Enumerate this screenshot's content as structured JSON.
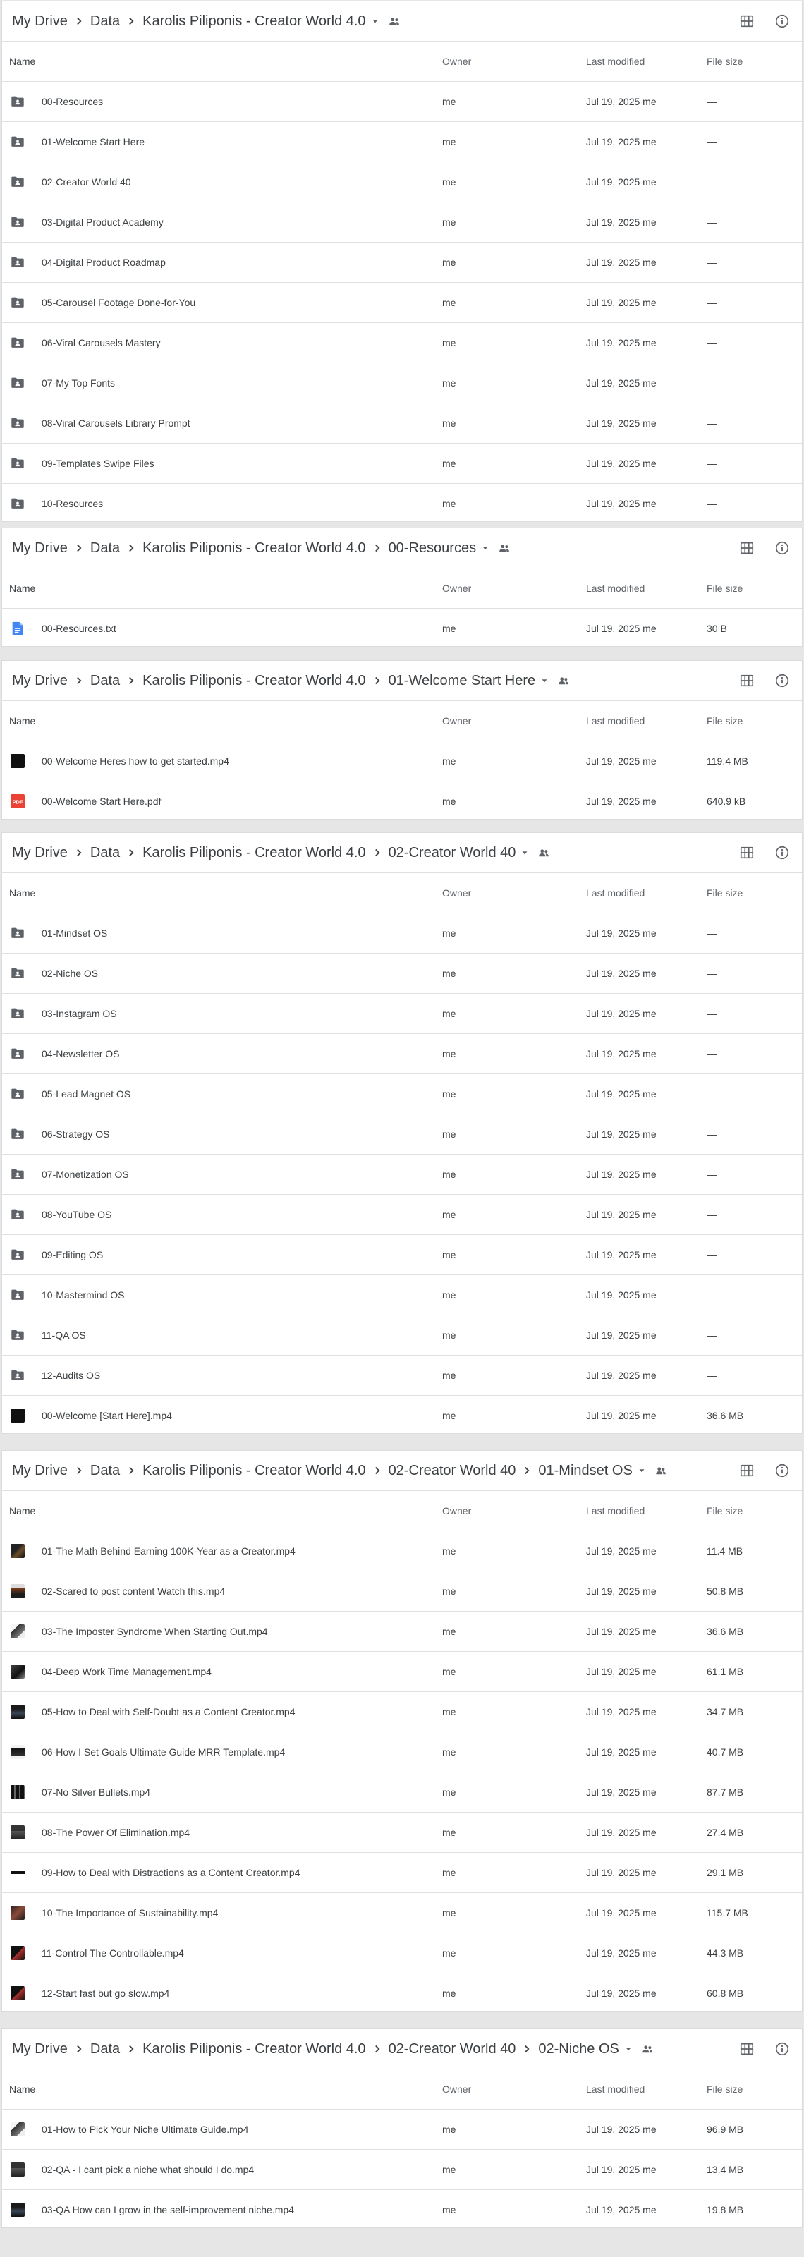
{
  "columns": {
    "name": "Name",
    "owner": "Owner",
    "modified": "Last modified",
    "size": "File size"
  },
  "sections": [
    {
      "path": [
        "My Drive",
        "Data",
        "Karolis Piliponis - Creator World 4.0"
      ],
      "rows": [
        {
          "icon": "folder-shared-icon",
          "name": "00-Resources",
          "owner": "me",
          "modified": "Jul 19, 2025 me",
          "size": "—"
        },
        {
          "icon": "folder-shared-icon",
          "name": "01-Welcome Start Here",
          "owner": "me",
          "modified": "Jul 19, 2025 me",
          "size": "—"
        },
        {
          "icon": "folder-shared-icon",
          "name": "02-Creator World 40",
          "owner": "me",
          "modified": "Jul 19, 2025 me",
          "size": "—"
        },
        {
          "icon": "folder-shared-icon",
          "name": "03-Digital Product Academy",
          "owner": "me",
          "modified": "Jul 19, 2025 me",
          "size": "—"
        },
        {
          "icon": "folder-shared-icon",
          "name": "04-Digital Product Roadmap",
          "owner": "me",
          "modified": "Jul 19, 2025 me",
          "size": "—"
        },
        {
          "icon": "folder-shared-icon",
          "name": "05-Carousel Footage Done-for-You",
          "owner": "me",
          "modified": "Jul 19, 2025 me",
          "size": "—"
        },
        {
          "icon": "folder-shared-icon",
          "name": "06-Viral Carousels Mastery",
          "owner": "me",
          "modified": "Jul 19, 2025 me",
          "size": "—"
        },
        {
          "icon": "folder-shared-icon",
          "name": "07-My Top Fonts",
          "owner": "me",
          "modified": "Jul 19, 2025 me",
          "size": "—"
        },
        {
          "icon": "folder-shared-icon",
          "name": "08-Viral Carousels Library Prompt",
          "owner": "me",
          "modified": "Jul 19, 2025 me",
          "size": "—"
        },
        {
          "icon": "folder-shared-icon",
          "name": "09-Templates Swipe Files",
          "owner": "me",
          "modified": "Jul 19, 2025 me",
          "size": "—"
        },
        {
          "icon": "folder-shared-icon",
          "name": "10-Resources",
          "owner": "me",
          "modified": "Jul 19, 2025 me",
          "size": "—"
        }
      ]
    },
    {
      "path": [
        "My Drive",
        "Data",
        "Karolis Piliponis - Creator World 4.0",
        "00-Resources"
      ],
      "rows": [
        {
          "icon": "doc-icon",
          "name": "00-Resources.txt",
          "owner": "me",
          "modified": "Jul 19, 2025 me",
          "size": "30 B"
        }
      ]
    },
    {
      "path": [
        "My Drive",
        "Data",
        "Karolis Piliponis - Creator World 4.0",
        "01-Welcome Start Here"
      ],
      "rows": [
        {
          "icon": "video-thumb-icon",
          "name": "00-Welcome Heres how to get started.mp4",
          "owner": "me",
          "modified": "Jul 19, 2025 me",
          "size": "119.4 MB"
        },
        {
          "icon": "pdf-icon",
          "name": "00-Welcome Start Here.pdf",
          "owner": "me",
          "modified": "Jul 19, 2025 me",
          "size": "640.9 kB"
        }
      ]
    },
    {
      "path": [
        "My Drive",
        "Data",
        "Karolis Piliponis - Creator World 4.0",
        "02-Creator World 40"
      ],
      "rows": [
        {
          "icon": "folder-shared-icon",
          "name": "01-Mindset OS",
          "owner": "me",
          "modified": "Jul 19, 2025 me",
          "size": "—"
        },
        {
          "icon": "folder-shared-icon",
          "name": "02-Niche OS",
          "owner": "me",
          "modified": "Jul 19, 2025 me",
          "size": "—"
        },
        {
          "icon": "folder-shared-icon",
          "name": "03-Instagram OS",
          "owner": "me",
          "modified": "Jul 19, 2025 me",
          "size": "—"
        },
        {
          "icon": "folder-shared-icon",
          "name": "04-Newsletter OS",
          "owner": "me",
          "modified": "Jul 19, 2025 me",
          "size": "—"
        },
        {
          "icon": "folder-shared-icon",
          "name": "05-Lead Magnet OS",
          "owner": "me",
          "modified": "Jul 19, 2025 me",
          "size": "—"
        },
        {
          "icon": "folder-shared-icon",
          "name": "06-Strategy OS",
          "owner": "me",
          "modified": "Jul 19, 2025 me",
          "size": "—"
        },
        {
          "icon": "folder-shared-icon",
          "name": "07-Monetization OS",
          "owner": "me",
          "modified": "Jul 19, 2025 me",
          "size": "—"
        },
        {
          "icon": "folder-shared-icon",
          "name": "08-YouTube OS",
          "owner": "me",
          "modified": "Jul 19, 2025 me",
          "size": "—"
        },
        {
          "icon": "folder-shared-icon",
          "name": "09-Editing OS",
          "owner": "me",
          "modified": "Jul 19, 2025 me",
          "size": "—"
        },
        {
          "icon": "folder-shared-icon",
          "name": "10-Mastermind OS",
          "owner": "me",
          "modified": "Jul 19, 2025 me",
          "size": "—"
        },
        {
          "icon": "folder-shared-icon",
          "name": "11-QA OS",
          "owner": "me",
          "modified": "Jul 19, 2025 me",
          "size": "—"
        },
        {
          "icon": "folder-shared-icon",
          "name": "12-Audits OS",
          "owner": "me",
          "modified": "Jul 19, 2025 me",
          "size": "—"
        },
        {
          "icon": "video-thumb-icon",
          "name": "00-Welcome [Start Here].mp4",
          "owner": "me",
          "modified": "Jul 19, 2025 me",
          "size": "36.6 MB"
        }
      ]
    },
    {
      "path": [
        "My Drive",
        "Data",
        "Karolis Piliponis - Creator World 4.0",
        "02-Creator World 40",
        "01-Mindset OS"
      ],
      "rows": [
        {
          "icon": "video-thumb-icon",
          "name": "01-The Math Behind Earning 100K-Year as a Creator.mp4",
          "owner": "me",
          "modified": "Jul 19, 2025 me",
          "size": "11.4 MB"
        },
        {
          "icon": "video-thumb-icon",
          "name": "02-Scared to post content Watch this.mp4",
          "owner": "me",
          "modified": "Jul 19, 2025 me",
          "size": "50.8 MB"
        },
        {
          "icon": "video-thumb-icon",
          "name": "03-The Imposter Syndrome When Starting Out.mp4",
          "owner": "me",
          "modified": "Jul 19, 2025 me",
          "size": "36.6 MB"
        },
        {
          "icon": "video-thumb-icon",
          "name": "04-Deep Work Time Management.mp4",
          "owner": "me",
          "modified": "Jul 19, 2025 me",
          "size": "61.1 MB"
        },
        {
          "icon": "video-thumb-icon",
          "name": "05-How to Deal with Self-Doubt as a Content Creator.mp4",
          "owner": "me",
          "modified": "Jul 19, 2025 me",
          "size": "34.7 MB"
        },
        {
          "icon": "video-thumb-icon",
          "name": "06-How I Set Goals Ultimate Guide MRR Template.mp4",
          "owner": "me",
          "modified": "Jul 19, 2025 me",
          "size": "40.7 MB"
        },
        {
          "icon": "video-thumb-icon",
          "name": "07-No Silver Bullets.mp4",
          "owner": "me",
          "modified": "Jul 19, 2025 me",
          "size": "87.7 MB"
        },
        {
          "icon": "video-thumb-icon",
          "name": "08-The Power Of Elimination.mp4",
          "owner": "me",
          "modified": "Jul 19, 2025 me",
          "size": "27.4 MB"
        },
        {
          "icon": "video-thumb-icon",
          "name": "09-How to Deal with Distractions as a Content Creator.mp4",
          "owner": "me",
          "modified": "Jul 19, 2025 me",
          "size": "29.1 MB"
        },
        {
          "icon": "video-thumb-icon",
          "name": "10-The Importance of Sustainability.mp4",
          "owner": "me",
          "modified": "Jul 19, 2025 me",
          "size": "115.7 MB"
        },
        {
          "icon": "video-thumb-icon",
          "name": "11-Control The Controllable.mp4",
          "owner": "me",
          "modified": "Jul 19, 2025 me",
          "size": "44.3 MB"
        },
        {
          "icon": "video-thumb-icon",
          "name": "12-Start fast but go slow.mp4",
          "owner": "me",
          "modified": "Jul 19, 2025 me",
          "size": "60.8 MB"
        }
      ]
    },
    {
      "path": [
        "My Drive",
        "Data",
        "Karolis Piliponis - Creator World 4.0",
        "02-Creator World 40",
        "02-Niche OS"
      ],
      "rows": [
        {
          "icon": "video-thumb-icon",
          "name": "01-How to Pick Your Niche Ultimate Guide.mp4",
          "owner": "me",
          "modified": "Jul 19, 2025 me",
          "size": "96.9 MB"
        },
        {
          "icon": "video-thumb-icon",
          "name": "02-QA - I cant pick a niche what should I do.mp4",
          "owner": "me",
          "modified": "Jul 19, 2025 me",
          "size": "13.4 MB"
        },
        {
          "icon": "video-thumb-icon",
          "name": "03-QA How can I grow in the self-improvement niche.mp4",
          "owner": "me",
          "modified": "Jul 19, 2025 me",
          "size": "19.8 MB"
        }
      ]
    }
  ]
}
